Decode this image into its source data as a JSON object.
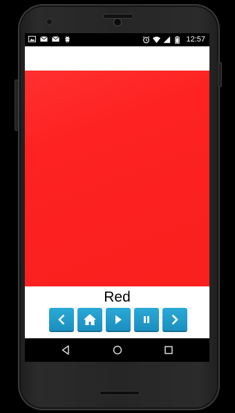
{
  "status_bar": {
    "left_icons": [
      "image-icon",
      "mail-icon",
      "mail-icon",
      "android-icon"
    ],
    "right_icons": [
      "alarm-icon",
      "wifi-icon",
      "signal-icon",
      "battery-icon"
    ],
    "time": "12:57"
  },
  "app": {
    "color_name": "Red",
    "color_hex": "#fe2222",
    "controls": [
      {
        "icon": "chevron-left-icon"
      },
      {
        "icon": "home-icon"
      },
      {
        "icon": "play-icon"
      },
      {
        "icon": "pause-icon"
      },
      {
        "icon": "chevron-right-icon"
      }
    ],
    "button_color": "#1d93c3"
  },
  "nav_bar": {
    "buttons": [
      "back-icon",
      "home-circle-icon",
      "recent-apps-icon"
    ]
  }
}
